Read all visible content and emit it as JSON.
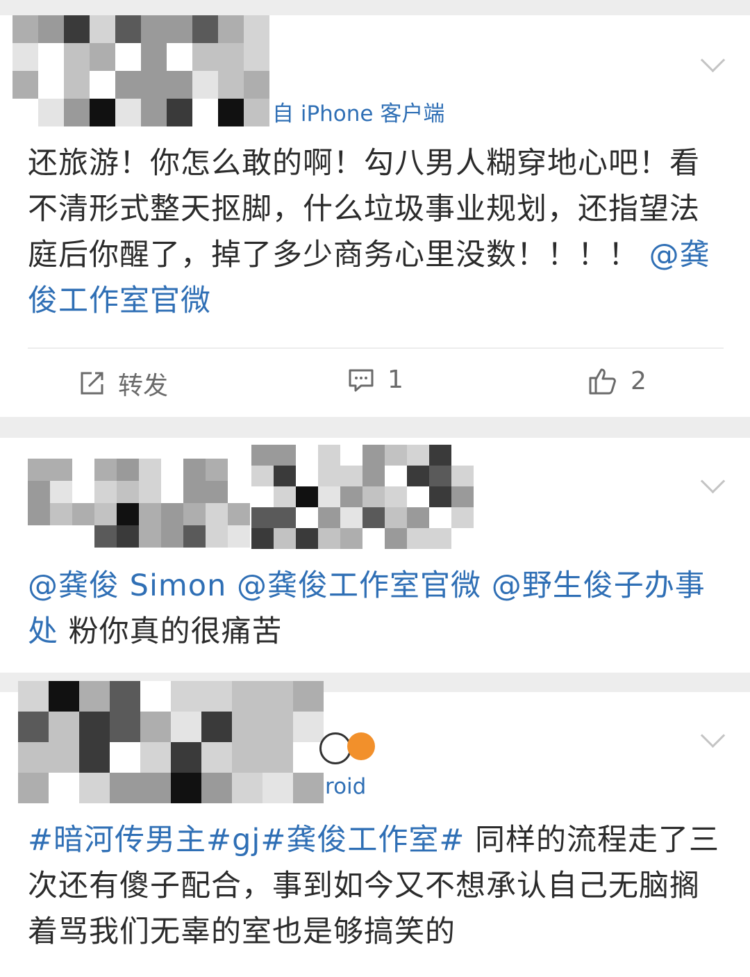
{
  "posts": [
    {
      "meta_suffix": "自 iPhone 客户端",
      "text_segments": [
        {
          "type": "text",
          "value": "还旅游！你怎么敢的啊！勾八男人糊穿地心吧！看不清形式整天抠脚，什么垃圾事业规划，还指望法庭后你醒了，掉了多少商务心里没数！！！！ "
        },
        {
          "type": "mention",
          "value": "@龚俊工作室官微"
        }
      ],
      "actions": {
        "repost_label": "转发",
        "comment_count": "1",
        "like_count": "2"
      }
    },
    {
      "text_segments": [
        {
          "type": "mention",
          "value": "@龚俊 Simon"
        },
        {
          "type": "text",
          "value": " "
        },
        {
          "type": "mention",
          "value": "@龚俊工作室官微"
        },
        {
          "type": "text",
          "value": " "
        },
        {
          "type": "mention",
          "value": "@野生俊子办事处"
        },
        {
          "type": "text",
          "value": " 粉你真的很痛苦"
        }
      ]
    },
    {
      "meta_suffix": "roid",
      "text_segments": [
        {
          "type": "hashtag",
          "value": "#暗河传男主#"
        },
        {
          "type": "hashtag",
          "value": "gj"
        },
        {
          "type": "hashtag",
          "value": "#龚俊工作室#"
        },
        {
          "type": "text",
          "value": " 同样的流程走了三次还有傻子配合，事到如今又不想承认自己无脑搁着骂我们无辜的室也是够搞笑的"
        }
      ]
    }
  ],
  "colors": {
    "link": "#2f6fb5",
    "text": "#2b2b2b",
    "muted": "#6a6a6a",
    "separator": "#ededed"
  },
  "icons": [
    "chevron-down-icon",
    "repost-icon",
    "comment-icon",
    "like-icon",
    "panda-emoji-icon",
    "pufferfish-emoji-icon"
  ]
}
